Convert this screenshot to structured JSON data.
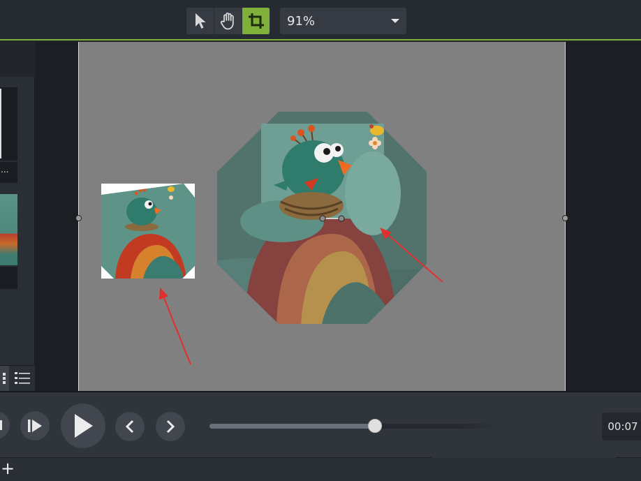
{
  "toolbar": {
    "tools": [
      {
        "name": "select",
        "icon": "arrow-pointer-icon",
        "active": false
      },
      {
        "name": "pan",
        "icon": "hand-icon",
        "active": false
      },
      {
        "name": "crop",
        "icon": "crop-icon",
        "active": true
      }
    ],
    "zoom": {
      "value": "91%"
    },
    "accent_color": "#7fb03a"
  },
  "left_panel": {
    "clip_label": "..."
  },
  "canvas": {
    "background": "#808080",
    "annotation_color": "#e03030"
  },
  "playback": {
    "buttons": [
      "previous-frame",
      "step-back",
      "play",
      "previous-marker",
      "next-marker"
    ],
    "progress": 0.56,
    "time": "00:07"
  },
  "bottom_bar": {
    "add_label": "+"
  }
}
